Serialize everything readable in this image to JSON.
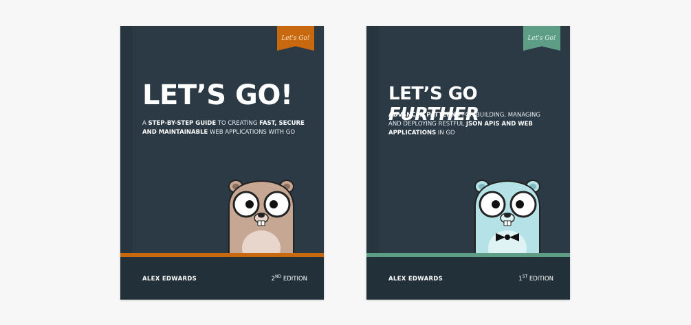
{
  "books": [
    {
      "ribbon": "Let's Go!",
      "title": "LET’S GO!",
      "subtitle": {
        "p1": "A ",
        "b1": "STEP-BY-STEP GUIDE",
        "p2": " TO CREATING ",
        "b2": "FAST, SECURE AND MAINTAINABLE",
        "p3": " WEB APPLICATIONS WITH GO"
      },
      "author": "ALEX EDWARDS",
      "edition_num": "2",
      "edition_sup": "ND",
      "edition_word": " EDITION",
      "accent": "#c8690f",
      "gopher_fur": "#c6a793"
    },
    {
      "ribbon": "Let's Go!",
      "title_main": "LET’S GO ",
      "title_em": "FURTHER",
      "subtitle": {
        "b1": "ADVANCED PATTERNS",
        "p1": " FOR BUILDING, MANAGING AND DEPLOYING RESTFUL ",
        "b2": "JSON APIS AND WEB APPLICATIONS",
        "p2": " IN GO"
      },
      "author": "ALEX EDWARDS",
      "edition_num": "1",
      "edition_sup": "ST",
      "edition_word": " EDITION",
      "accent": "#5e9e86",
      "gopher_fur": "#b4e2e6"
    }
  ]
}
